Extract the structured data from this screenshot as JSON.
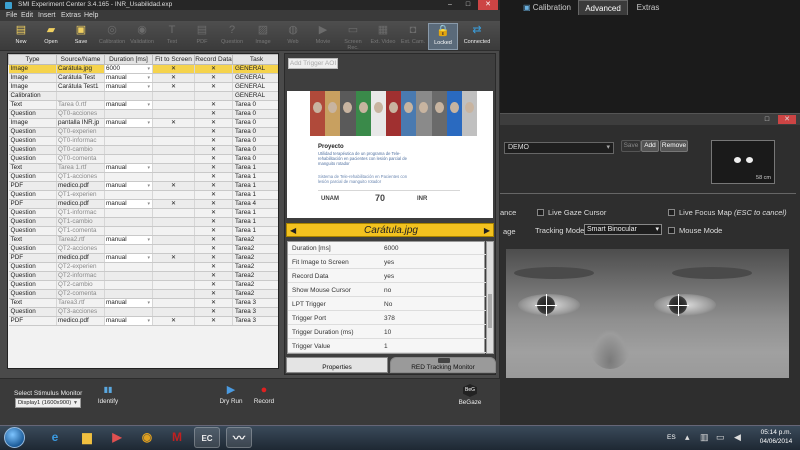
{
  "window": {
    "title": "SMI Experiment Center 3.4.165 - INR_Usabilidad.exp"
  },
  "menu": [
    "File",
    "Edit",
    "Insert",
    "Extras",
    "Help"
  ],
  "toolbar": [
    {
      "label": "New",
      "icon": "new-icon",
      "active": true
    },
    {
      "label": "Open",
      "icon": "open-icon",
      "active": true
    },
    {
      "label": "Save",
      "icon": "save-icon",
      "active": true
    },
    {
      "label": "Calibration",
      "icon": "calibration-icon",
      "active": false
    },
    {
      "label": "Validation",
      "icon": "validation-icon",
      "active": false
    },
    {
      "label": "Text",
      "icon": "text-icon",
      "active": false
    },
    {
      "label": "PDF",
      "icon": "pdf-icon",
      "active": false
    },
    {
      "label": "Question",
      "icon": "question-icon",
      "active": false
    },
    {
      "label": "Image",
      "icon": "image-icon",
      "active": false
    },
    {
      "label": "Web",
      "icon": "web-icon",
      "active": false
    },
    {
      "label": "Movie",
      "icon": "movie-icon",
      "active": false
    },
    {
      "label": "Screen Rec.",
      "icon": "screen-rec-icon",
      "active": false
    },
    {
      "label": "Ext. Video",
      "icon": "ext-video-icon",
      "active": false
    },
    {
      "label": "Ext. Cam.",
      "icon": "ext-cam-icon",
      "active": false
    },
    {
      "label": "Locked",
      "icon": "lock-icon",
      "active": true
    },
    {
      "label": "Connected",
      "icon": "connected-icon",
      "active": true
    }
  ],
  "grid": {
    "columns": [
      "Type",
      "Source/Name",
      "Duration [ms]",
      "Fit to Screen",
      "Record Data",
      "Task"
    ],
    "rows": [
      {
        "type": "Image",
        "source": "Carátula.jpg",
        "duration": "6000",
        "fit": "✕",
        "record": "✕",
        "task": "GENERAL",
        "selected": true
      },
      {
        "type": "Image",
        "source": "Carátula Test",
        "duration": "manual",
        "fit": "✕",
        "record": "✕",
        "task": "GENERAL"
      },
      {
        "type": "Image",
        "source": "Carátula Test1",
        "duration": "manual",
        "fit": "✕",
        "record": "✕",
        "task": "GENERAL"
      },
      {
        "type": "Calibration",
        "source": "",
        "duration": "",
        "fit": "",
        "record": "",
        "task": "GENERAL"
      },
      {
        "type": "Text",
        "source": "Tarea 0.rtf",
        "duration": "manual",
        "fit": "",
        "record": "✕",
        "task": "Tarea 0",
        "dim": true
      },
      {
        "type": "Question",
        "source": "QT0-acciones",
        "duration": "",
        "fit": "",
        "record": "✕",
        "task": "Tarea 0",
        "dim": true
      },
      {
        "type": "Image",
        "source": "pantalla INR.jp",
        "duration": "manual",
        "fit": "✕",
        "record": "✕",
        "task": "Tarea 0"
      },
      {
        "type": "Question",
        "source": "QT0-experien",
        "duration": "",
        "fit": "",
        "record": "✕",
        "task": "Tarea 0",
        "dim": true
      },
      {
        "type": "Question",
        "source": "QT0-informac",
        "duration": "",
        "fit": "",
        "record": "✕",
        "task": "Tarea 0",
        "dim": true
      },
      {
        "type": "Question",
        "source": "QT0-cambio",
        "duration": "",
        "fit": "",
        "record": "✕",
        "task": "Tarea 0",
        "dim": true
      },
      {
        "type": "Question",
        "source": "QT0-comenta",
        "duration": "",
        "fit": "",
        "record": "✕",
        "task": "Tarea 0",
        "dim": true
      },
      {
        "type": "Text",
        "source": "Tarea 1.rtf",
        "duration": "manual",
        "fit": "",
        "record": "✕",
        "task": "Tarea 1",
        "dim": true
      },
      {
        "type": "Question",
        "source": "QT1-acciones",
        "duration": "",
        "fit": "",
        "record": "✕",
        "task": "Tarea 1",
        "dim": true
      },
      {
        "type": "PDF",
        "source": "medico.pdf",
        "duration": "manual",
        "fit": "✕",
        "record": "✕",
        "task": "Tarea 1"
      },
      {
        "type": "Question",
        "source": "QT1-experien",
        "duration": "",
        "fit": "",
        "record": "✕",
        "task": "Tarea 1",
        "dim": true
      },
      {
        "type": "PDF",
        "source": "medico.pdf",
        "duration": "manual",
        "fit": "✕",
        "record": "✕",
        "task": "Tarea 4"
      },
      {
        "type": "Question",
        "source": "QT1-informac",
        "duration": "",
        "fit": "",
        "record": "✕",
        "task": "Tarea 1",
        "dim": true
      },
      {
        "type": "Question",
        "source": "QT1-cambio",
        "duration": "",
        "fit": "",
        "record": "✕",
        "task": "Tarea 1",
        "dim": true
      },
      {
        "type": "Question",
        "source": "QT1-comenta",
        "duration": "",
        "fit": "",
        "record": "✕",
        "task": "Tarea 1",
        "dim": true
      },
      {
        "type": "Text",
        "source": "Tarea2.rtf",
        "duration": "manual",
        "fit": "",
        "record": "✕",
        "task": "Tarea2",
        "dim": true
      },
      {
        "type": "Question",
        "source": "QT2-acciones",
        "duration": "",
        "fit": "",
        "record": "✕",
        "task": "Tarea2",
        "dim": true
      },
      {
        "type": "PDF",
        "source": "medico.pdf",
        "duration": "manual",
        "fit": "✕",
        "record": "✕",
        "task": "Tarea2"
      },
      {
        "type": "Question",
        "source": "QT2-experien",
        "duration": "",
        "fit": "",
        "record": "✕",
        "task": "Tarea2",
        "dim": true
      },
      {
        "type": "Question",
        "source": "QT2-informac",
        "duration": "",
        "fit": "",
        "record": "✕",
        "task": "Tarea2",
        "dim": true
      },
      {
        "type": "Question",
        "source": "QT2-cambio",
        "duration": "",
        "fit": "",
        "record": "✕",
        "task": "Tarea2",
        "dim": true
      },
      {
        "type": "Question",
        "source": "QT2-comenta",
        "duration": "",
        "fit": "",
        "record": "✕",
        "task": "Tarea2",
        "dim": true
      },
      {
        "type": "Text",
        "source": "Tarea3.rtf",
        "duration": "manual",
        "fit": "",
        "record": "✕",
        "task": "Tarea 3",
        "dim": true
      },
      {
        "type": "Question",
        "source": "QT3-acciones",
        "duration": "",
        "fit": "",
        "record": "✕",
        "task": "Tarea 3",
        "dim": true
      },
      {
        "type": "PDF",
        "source": "medico.pdf",
        "duration": "manual",
        "fit": "✕",
        "record": "✕",
        "task": "Tarea 3"
      }
    ]
  },
  "preview": {
    "trigger_button": "Add Trigger AOI",
    "slide_title": "Proyecto",
    "slide_text": "Utilidad terapéutica de un programa de Tele-rehabilitación en pacientes con lesión parcial de manguito rotador",
    "slide_text2": "Sistema de Tele-rehabilitación en Pacientes con lesión parcial de manguito rotador",
    "logo1": "UNAM",
    "logo2": "70",
    "logo3": "INR",
    "filename": "Carátula.jpg",
    "prev_arrow": "◀",
    "next_arrow": "▶",
    "photo_colors": [
      "#b04a3a",
      "#c8a060",
      "#5a5a5a",
      "#3a8a4a",
      "#e8e8e8",
      "#a03030",
      "#4a7ab0",
      "#8a8a8a",
      "#6a6a6a",
      "#2a6ac0",
      "#c0c0c0"
    ]
  },
  "properties": [
    {
      "key": "Duration [ms]",
      "value": "6000"
    },
    {
      "key": "Fit Image to Screen",
      "value": "yes"
    },
    {
      "key": "Record Data",
      "value": "yes"
    },
    {
      "key": "Show Mouse Cursor",
      "value": "no"
    },
    {
      "key": "LPT Trigger",
      "value": "No"
    },
    {
      "key": "Trigger Port",
      "value": "378"
    },
    {
      "key": "Trigger Duration (ms)",
      "value": "10"
    },
    {
      "key": "Trigger Value",
      "value": "1"
    }
  ],
  "panel_tabs": {
    "properties": "Properties",
    "red": "RED Tracking Monitor"
  },
  "bottom": {
    "monitor_label": "Select Stimulus Monitor",
    "monitor_value": "Display1 (1600x900)",
    "identify": "Identify",
    "dry_run": "Dry Run",
    "record": "Record",
    "begaze": "BeGaze",
    "begaze_mark": "BeG"
  },
  "tracking": {
    "profile": "DEMO",
    "save": "Save",
    "add": "Add",
    "remove": "Remove",
    "distance": "58 cm",
    "tabs": [
      "Calibration",
      "Advanced",
      "Extras"
    ],
    "options": {
      "ance": "ance",
      "live_gaze": "Live Gaze Cursor",
      "live_focus": "Live Focus Map",
      "live_focus_note": "(ESC to cancel)",
      "age": "age",
      "tracking_mode_label": "Tracking Mode",
      "tracking_mode_value": "Smart Binocular",
      "mouse_mode": "Mouse Mode"
    }
  },
  "taskbar": {
    "lang": "ES",
    "time": "05:14 p.m.",
    "date": "04/06/2014"
  }
}
